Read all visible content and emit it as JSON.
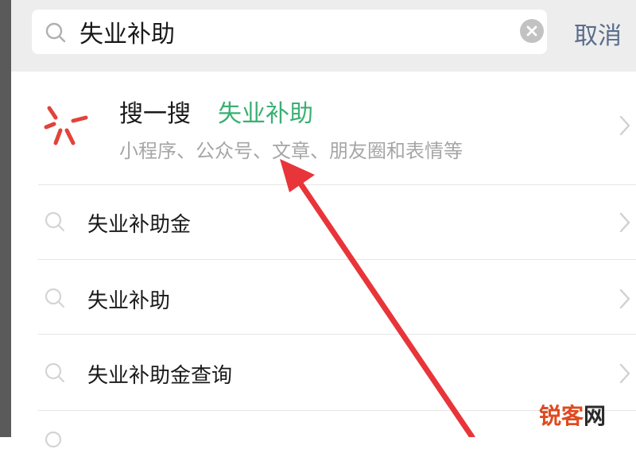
{
  "search": {
    "value": "失业补助",
    "cancel_label": "取消"
  },
  "souyisou": {
    "title": "搜一搜",
    "keyword": "失业补助",
    "subtitle": "小程序、公众号、文章、朋友圈和表情等"
  },
  "suggestions": [
    {
      "label": "失业补助金"
    },
    {
      "label": "失业补助"
    },
    {
      "label": "失业补助金查询"
    }
  ],
  "watermark": {
    "part_a": "锐客",
    "part_b": "网"
  },
  "colors": {
    "accent_green": "#3ab073",
    "cancel_blue": "#5a6d8c",
    "souyisou_red": "#e0443a",
    "arrow_red": "#e8353a"
  }
}
